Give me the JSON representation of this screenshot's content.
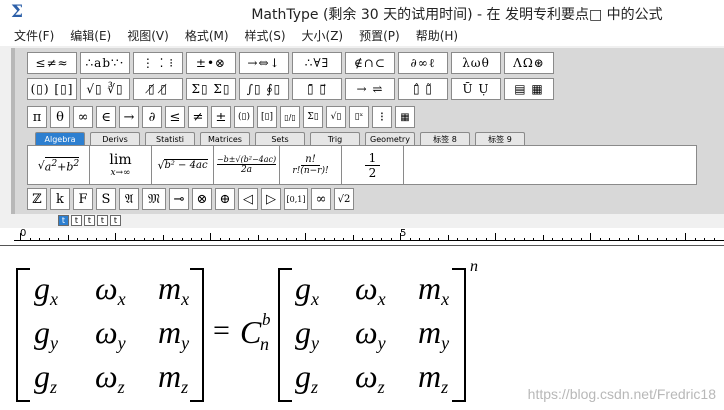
{
  "window": {
    "app_icon": "Σ",
    "title": "MathType (剩余 30 天的试用时间) - 在 发明专利要点□ 中的公式"
  },
  "menu": [
    "文件(F)",
    "编辑(E)",
    "视图(V)",
    "格式(M)",
    "样式(S)",
    "大小(Z)",
    "预置(P)",
    "帮助(H)"
  ],
  "toolbar": {
    "row1": [
      "≤≠≈",
      "∴ab∵·",
      "⋮ ⁚ ⁝",
      "±•⊗",
      "→⇔↓",
      "∴∀∃",
      "∉∩⊂",
      "∂∞ℓ",
      "λωθ",
      "ΛΩ⊛"
    ],
    "row2": [
      "(▯) [▯]",
      "√▯ ∛▯",
      "▯̸ ▯̸",
      "Σ▯ Σ▯",
      "∫▯ ∮▯",
      "▯̄ ▯⃗",
      "→ ⇌",
      "▯̂ ▯̃",
      "Ū Ụ",
      "▤ ▦"
    ],
    "row3": [
      "π",
      "θ",
      "∞",
      "∈",
      "→",
      "∂",
      "≤",
      "≠",
      "±",
      "(▯)",
      "[▯]",
      "▯/▯",
      "Σ▯",
      "√▯",
      "▯ˣ",
      "⁝",
      "▦"
    ],
    "tabs": [
      "Algebra",
      "Derivs",
      "Statisti",
      "Matrices",
      "Sets",
      "Trig",
      "Geometry",
      "标签 8",
      "标签 9"
    ],
    "templates": {
      "t1_rad": "a",
      "t1_sup1": "2",
      "t1_plus": "+",
      "t1_b": "b",
      "t1_sup2": "2",
      "t2_lim": "lim",
      "t2_sub": "x→∞",
      "t3": "b² − 4ac",
      "t4_num": "−b±√(b²−4ac)",
      "t4_den": "2a",
      "t5_num": "n!",
      "t5_den": "r!(n−r)!",
      "t6_num": "1",
      "t6_den": "2"
    },
    "row5": [
      "ℤ",
      "k",
      "F",
      "S",
      "𝔄",
      "𝔐",
      "⊸",
      "⊗",
      "⊕",
      "◁",
      "▷",
      "[0,1]",
      "∞",
      "√2"
    ]
  },
  "size_icons": [
    "t",
    "t",
    "t",
    "t",
    "t"
  ],
  "ruler": {
    "marks": [
      "0",
      "1",
      "5"
    ]
  },
  "equation": {
    "left_matrix": [
      [
        "g",
        "x",
        "ω",
        "x",
        "m",
        "x"
      ],
      [
        "g",
        "y",
        "ω",
        "y",
        "m",
        "y"
      ],
      [
        "g",
        "z",
        "ω",
        "z",
        "m",
        "z"
      ]
    ],
    "equals": "=",
    "C": "C",
    "C_sup": "b",
    "C_sub": "n",
    "right_matrix": [
      [
        "g",
        "x",
        "ω",
        "x",
        "m",
        "x"
      ],
      [
        "g",
        "y",
        "ω",
        "y",
        "m",
        "y"
      ],
      [
        "g",
        "z",
        "ω",
        "z",
        "m",
        "z"
      ]
    ],
    "power": "n"
  },
  "watermark": "https://blog.csdn.net/Fredric18"
}
